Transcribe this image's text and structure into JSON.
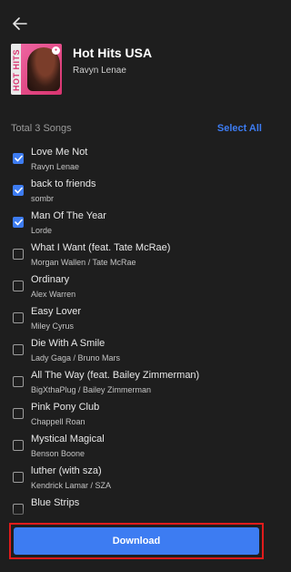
{
  "playlist": {
    "title": "Hot Hits USA",
    "artist": "Ravyn Lenae",
    "cover_text": "HOT HITS"
  },
  "list_header": {
    "total_label": "Total 3 Songs",
    "select_all_label": "Select All"
  },
  "songs": [
    {
      "title": "Love Me Not",
      "artist": "Ravyn Lenae",
      "checked": true
    },
    {
      "title": "back to friends",
      "artist": "sombr",
      "checked": true
    },
    {
      "title": "Man Of The Year",
      "artist": "Lorde",
      "checked": true
    },
    {
      "title": "What I Want (feat. Tate McRae)",
      "artist": "Morgan Wallen / Tate McRae",
      "checked": false
    },
    {
      "title": "Ordinary",
      "artist": "Alex Warren",
      "checked": false
    },
    {
      "title": "Easy Lover",
      "artist": "Miley Cyrus",
      "checked": false
    },
    {
      "title": "Die With A Smile",
      "artist": "Lady Gaga / Bruno Mars",
      "checked": false
    },
    {
      "title": "All The Way (feat. Bailey Zimmerman)",
      "artist": "BigXthaPlug / Bailey Zimmerman",
      "checked": false
    },
    {
      "title": "Pink Pony Club",
      "artist": "Chappell Roan",
      "checked": false
    },
    {
      "title": "Mystical Magical",
      "artist": "Benson Boone",
      "checked": false
    },
    {
      "title": "luther (with sza)",
      "artist": "Kendrick Lamar / SZA",
      "checked": false
    },
    {
      "title": "Blue Strips",
      "artist": "",
      "checked": false
    }
  ],
  "download_label": "Download",
  "colors": {
    "accent": "#3d7cf2",
    "highlight_border": "#e11b1b",
    "background": "#1e1e1e"
  },
  "icons": {
    "back": "arrow-left-icon",
    "checkbox": "checkmark-icon"
  }
}
